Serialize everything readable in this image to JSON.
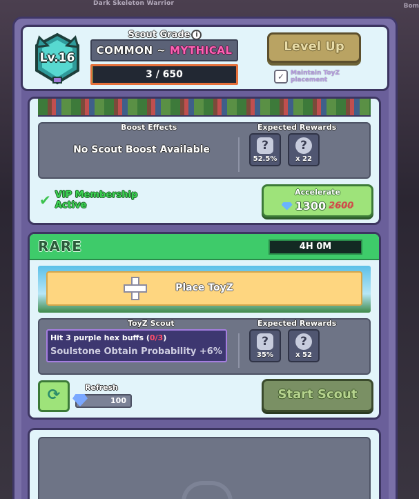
{
  "background": {
    "top_title": "Dark Skeleton Warrior",
    "right_label": "Bom"
  },
  "header": {
    "level": "Lv.16",
    "grade_label": "Scout Grade",
    "grade_from": "COMMON",
    "grade_sep": " ~ ",
    "grade_to": "MYTHICAL",
    "progress_text": "3 / 650",
    "progress_fraction": 0.0046,
    "level_up_label": "Level Up",
    "maintain_label": "Maintain ToyZ placement"
  },
  "slot1": {
    "boost_header": "Boost Effects",
    "rewards_header": "Expected Rewards",
    "boost_text": "No Scout Boost Available",
    "rewards": [
      {
        "icon": "mystery-toy-icon",
        "value": "52.5%"
      },
      {
        "icon": "mystery-item-icon",
        "value": "x 22"
      }
    ],
    "vip_text": "VIP Membership Active",
    "accelerate_label": "Accelerate",
    "accelerate_cost": "1300",
    "accelerate_old_cost": "2600"
  },
  "slot2": {
    "rarity": "RARE",
    "timer": "4H 0M",
    "place_label": "Place ToyZ",
    "scout_header": "ToyZ Scout",
    "rewards_header": "Expected Rewards",
    "mission_text": "Hit 3 purple hex buffs (",
    "mission_progress": "0/3",
    "mission_close": ")",
    "mission_bonus": "Soulstone Obtain Probability +6%",
    "rewards": [
      {
        "icon": "mystery-toy-icon",
        "value": "35%"
      },
      {
        "icon": "mystery-item-icon",
        "value": "x 52"
      }
    ],
    "refresh_label": "Refresh",
    "refresh_cost": "100",
    "start_label": "Start Scout"
  },
  "colors": {
    "panel": "#7a70a8",
    "card": "#e2f4fa",
    "rare": "#3ecb6a",
    "mythical": "#ff62b4"
  }
}
